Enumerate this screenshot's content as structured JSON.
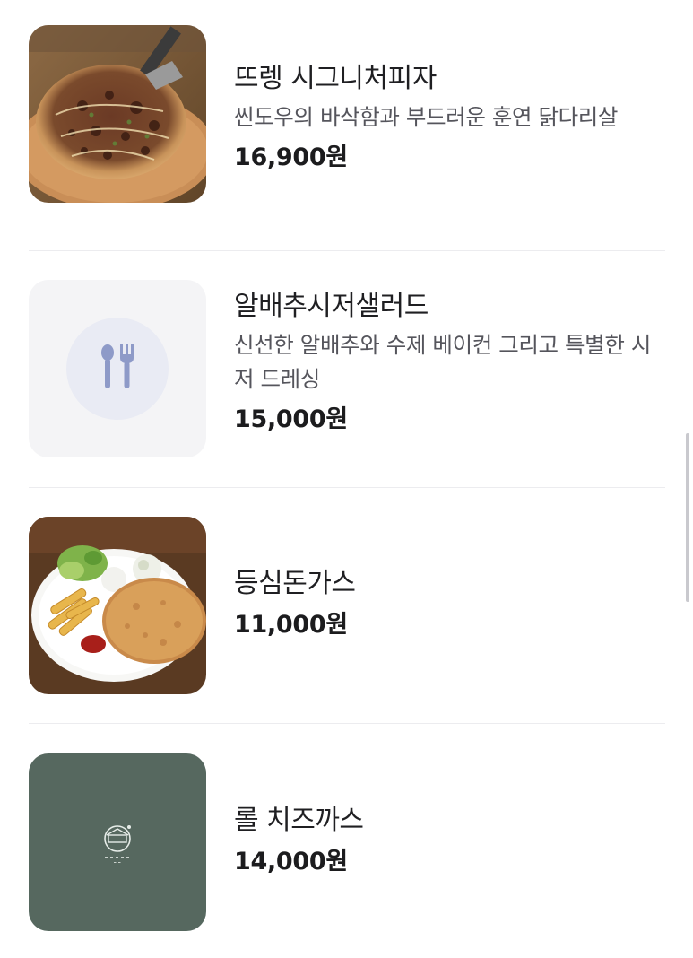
{
  "menu": {
    "items": [
      {
        "name": "뜨렝 시그니처피자",
        "description": "씬도우의 바삭함과 부드러운 훈연 닭다리살",
        "price": "16,900원",
        "image": "pizza-photo"
      },
      {
        "name": "알배추시저샐러드",
        "description": "신선한 알배추와 수제 베이컨 그리고 특별한 시저 드레싱",
        "price": "15,000원",
        "image": "utensils-placeholder-icon"
      },
      {
        "name": "등심돈가스",
        "description": "",
        "price": "11,000원",
        "image": "pork-cutlet-photo"
      },
      {
        "name": "롤 치즈까스",
        "description": "",
        "price": "14,000원",
        "image": "restaurant-logo"
      }
    ]
  },
  "colors": {
    "placeholder_bg": "#f4f4f6",
    "placeholder_circle": "#e9ebf4",
    "placeholder_icon": "#8e9ac8",
    "logo_bg": "#56685f",
    "divider": "#ececef",
    "price_text": "#1c1c1e",
    "desc_text": "#55555c"
  }
}
